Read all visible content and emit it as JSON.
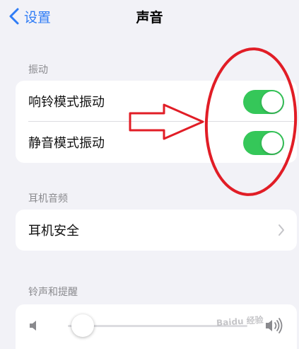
{
  "navbar": {
    "back_label": "设置",
    "title": "声音"
  },
  "sections": {
    "vibration": {
      "header": "振动",
      "rows": [
        {
          "label": "响铃模式振动",
          "on": true
        },
        {
          "label": "静音模式振动",
          "on": true
        }
      ]
    },
    "headphone_audio": {
      "header": "耳机音频",
      "rows": [
        {
          "label": "耳机安全"
        }
      ]
    },
    "ringtone_alerts": {
      "header": "铃声和提醒",
      "volume": 0.05
    }
  },
  "colors": {
    "accent": "#2f7cf6",
    "toggle_on": "#35c759",
    "annotation_red": "#e11d26",
    "background": "#f2f2f7"
  },
  "icons": {
    "back": "chevron-left-icon",
    "disclosure": "chevron-right-icon",
    "volume_low": "speaker-low-icon",
    "volume_high": "speaker-high-icon"
  },
  "watermark": "Baidu 经验"
}
